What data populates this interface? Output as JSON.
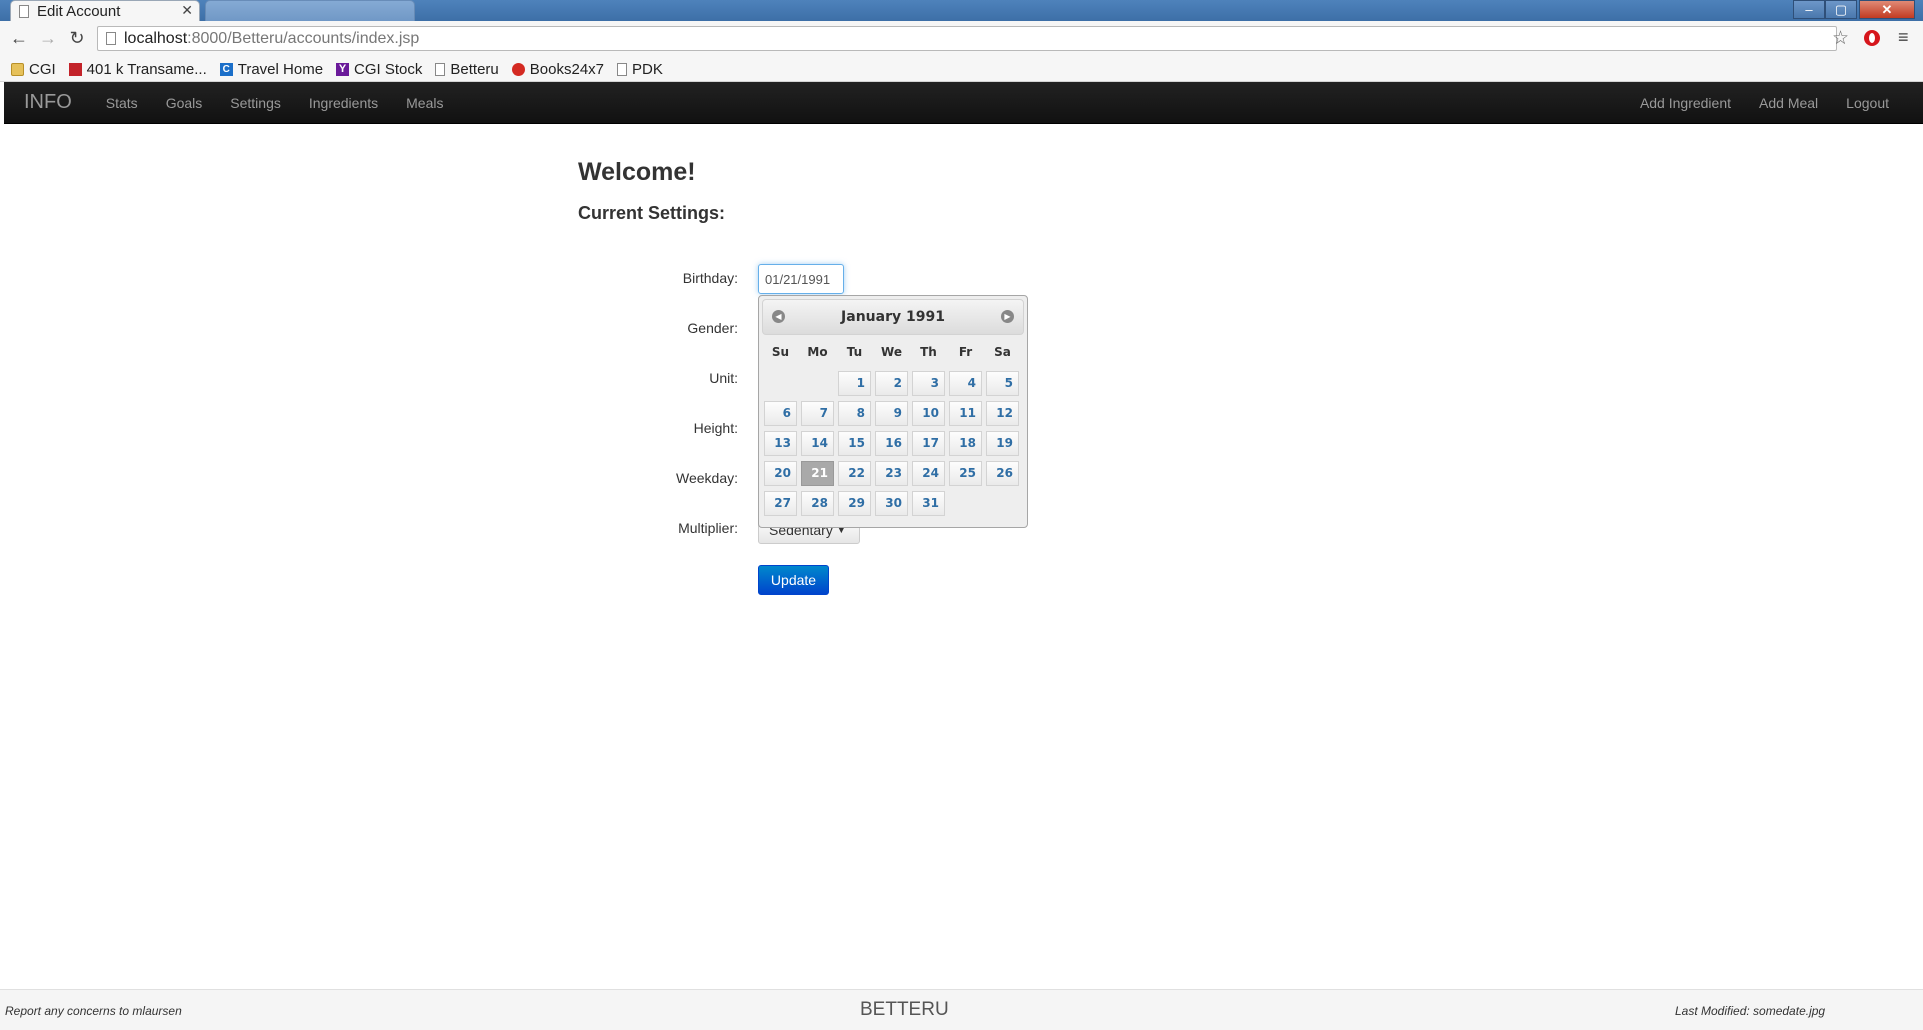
{
  "browser": {
    "tabs": [
      {
        "title": "Edit Account",
        "active": true
      },
      {
        "title": "",
        "active": false
      }
    ],
    "close_glyph": "✕",
    "url_host": "localhost",
    "url_rest": ":8000/Betteru/accounts/index.jsp",
    "window_controls": {
      "minimize": "–",
      "maximize": "▢",
      "close": "✕"
    },
    "bookmarks": [
      {
        "label": "CGI",
        "icon": "folder-icon"
      },
      {
        "label": "401 k Transame...",
        "icon": "bookmark-red-icon"
      },
      {
        "label": "Travel Home",
        "icon": "travel-icon"
      },
      {
        "label": "CGI Stock",
        "icon": "yahoo-icon"
      },
      {
        "label": "Betteru",
        "icon": "page-icon"
      },
      {
        "label": "Books24x7",
        "icon": "books-icon"
      },
      {
        "label": "PDK",
        "icon": "page-icon"
      }
    ]
  },
  "navbar": {
    "brand": "INFO",
    "left_links": [
      "Stats",
      "Goals",
      "Settings",
      "Ingredients",
      "Meals"
    ],
    "right_links": [
      "Add Ingredient",
      "Add Meal",
      "Logout"
    ]
  },
  "main": {
    "title": "Welcome!",
    "subtitle": "Current Settings:",
    "labels": {
      "birthday": "Birthday:",
      "gender": "Gender:",
      "unit": "Unit:",
      "height": "Height:",
      "weekday": "Weekday:",
      "multiplier": "Multiplier:"
    },
    "birthday_value": "01/21/1991",
    "multiplier_value": "Sedentary",
    "update_label": "Update"
  },
  "datepicker": {
    "month_year": "January 1991",
    "dow": [
      "Su",
      "Mo",
      "Tu",
      "We",
      "Th",
      "Fr",
      "Sa"
    ],
    "weeks": [
      [
        null,
        null,
        1,
        2,
        3,
        4,
        5
      ],
      [
        6,
        7,
        8,
        9,
        10,
        11,
        12
      ],
      [
        13,
        14,
        15,
        16,
        17,
        18,
        19
      ],
      [
        20,
        21,
        22,
        23,
        24,
        25,
        26
      ],
      [
        27,
        28,
        29,
        30,
        31,
        null,
        null
      ]
    ],
    "selected": 21
  },
  "footer": {
    "left": "Report any concerns to mlaursen",
    "center": "BETTERU",
    "right": "Last Modified: somedate.jpg"
  }
}
